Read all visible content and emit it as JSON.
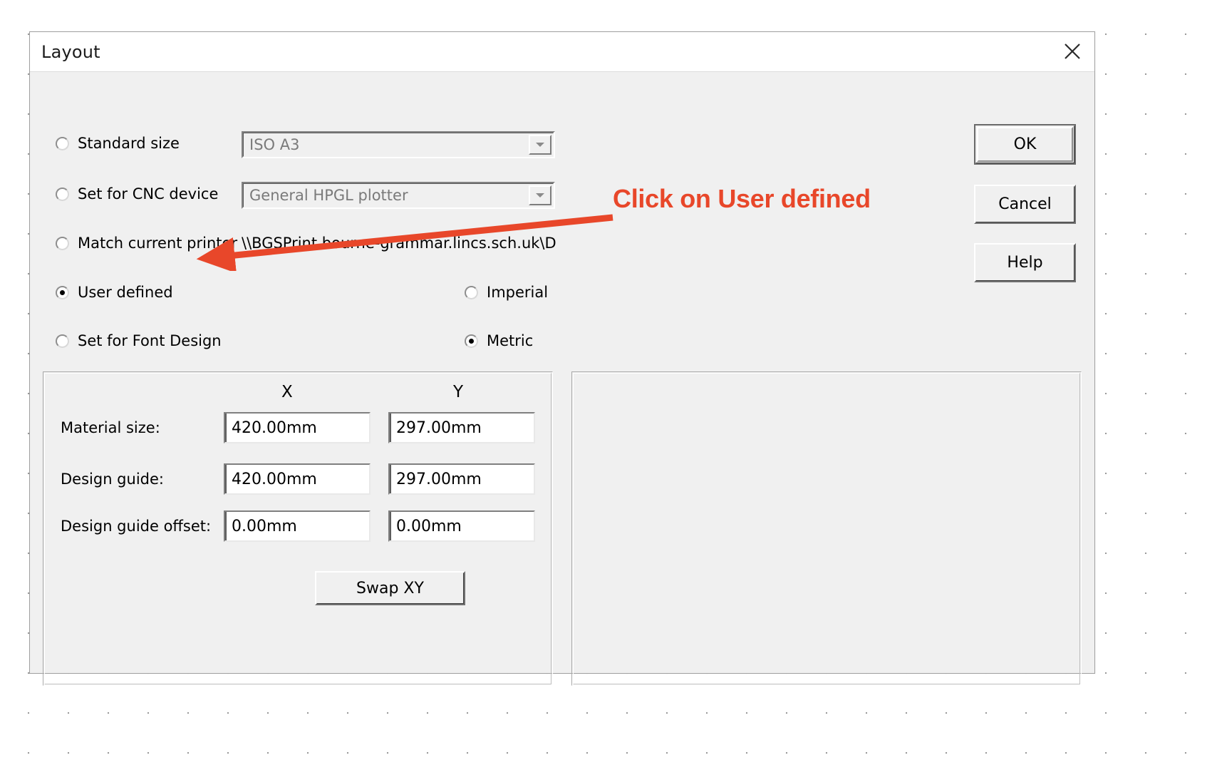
{
  "window": {
    "title": "Layout",
    "close_icon": "close-icon"
  },
  "options": {
    "standard_size": {
      "label": "Standard size",
      "selected": false,
      "value": "ISO A3"
    },
    "cnc_device": {
      "label": "Set for CNC device",
      "selected": false,
      "value": "General HPGL plotter"
    },
    "match_printer": {
      "label": "Match current printer",
      "selected": false,
      "value": "\\\\BGSPrint.bourne-grammar.lincs.sch.uk\\D"
    },
    "user_defined": {
      "label": "User defined",
      "selected": true
    },
    "font_design": {
      "label": "Set for Font Design",
      "selected": false
    }
  },
  "units": {
    "imperial": {
      "label": "Imperial",
      "selected": false
    },
    "metric": {
      "label": "Metric",
      "selected": true
    }
  },
  "dimensions": {
    "col_x": "X",
    "col_y": "Y",
    "rows": [
      {
        "label": "Material size:",
        "x": "420.00mm",
        "y": "297.00mm"
      },
      {
        "label": "Design guide:",
        "x": "420.00mm",
        "y": "297.00mm"
      },
      {
        "label": "Design guide offset:",
        "x": "0.00mm",
        "y": "0.00mm"
      }
    ],
    "swap_button": "Swap XY"
  },
  "buttons": {
    "ok": "OK",
    "cancel": "Cancel",
    "help": "Help"
  },
  "annotation": {
    "text": "Click on User defined",
    "color": "#e8472a"
  },
  "colors": {
    "dialog_face": "#f0f0f0",
    "titlebar": "#ffffff",
    "text": "#000000",
    "disabled_text": "#7a7a7a",
    "annotation": "#e8472a"
  }
}
